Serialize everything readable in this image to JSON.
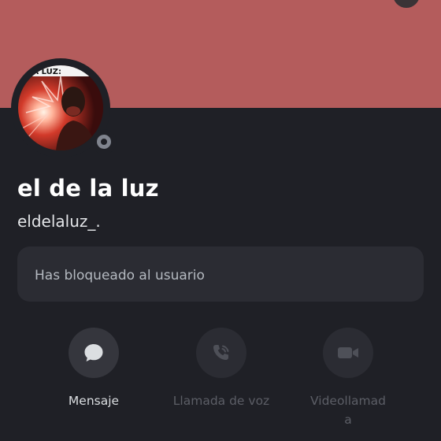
{
  "profile": {
    "display_name": "el de la luz",
    "username": "eldelaluz_.",
    "avatar_caption": "LA LUZ:",
    "status": "offline"
  },
  "notice": {
    "blocked_text": "Has bloqueado al usuario"
  },
  "actions": [
    {
      "label": "Mensaje",
      "icon": "chat-bubble-icon",
      "enabled": true
    },
    {
      "label": "Llamada de voz",
      "icon": "phone-call-icon",
      "enabled": false
    },
    {
      "label": "Videollamada",
      "icon": "video-camera-icon",
      "enabled": false
    }
  ],
  "colors": {
    "banner": "#b45c5c",
    "background": "#1f2026",
    "card": "#2b2c33",
    "status_offline": "#80848e"
  }
}
